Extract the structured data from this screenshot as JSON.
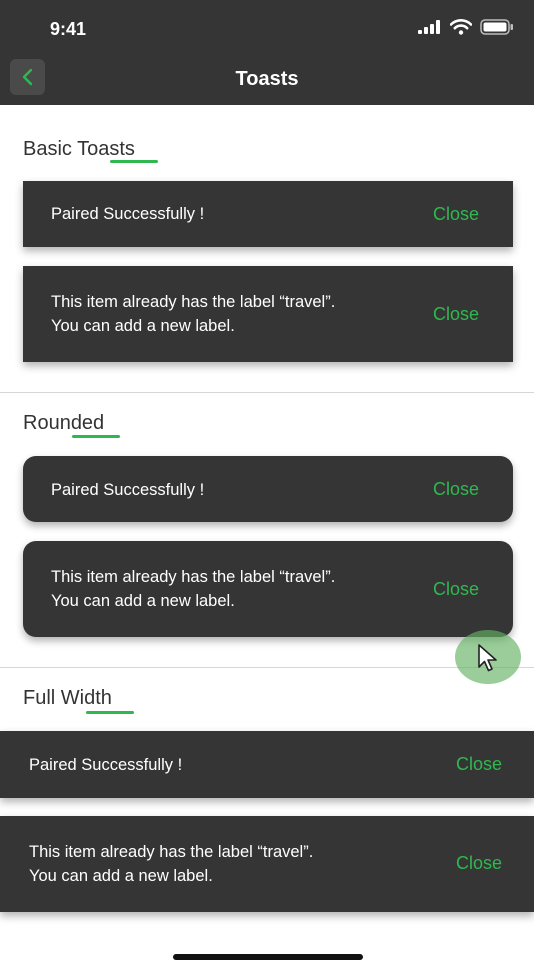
{
  "status_bar": {
    "time": "9:41",
    "icons": [
      "signal-icon",
      "wifi-icon",
      "battery-icon"
    ]
  },
  "nav": {
    "title": "Toasts",
    "back_icon": "chevron-left-icon"
  },
  "colors": {
    "bar_background": "#353535",
    "toast_background": "#353535",
    "accent": "#2fb84f",
    "text_light": "#ffffff",
    "section_text": "#333333"
  },
  "sections": [
    {
      "title": "Basic Toasts",
      "toasts": [
        {
          "message": "Paired Successfully !",
          "action": "Close"
        },
        {
          "message": "This item already has the label “travel”. You can add a new label.",
          "action": "Close"
        }
      ]
    },
    {
      "title": "Rounded",
      "toasts": [
        {
          "message": "Paired Successfully !",
          "action": "Close"
        },
        {
          "message": "This item already has the label “travel”. You can add a new label.",
          "action": "Close"
        }
      ]
    },
    {
      "title": "Full Width",
      "toasts": [
        {
          "message": "Paired Successfully !",
          "action": "Close"
        },
        {
          "message": "This item already has the label “travel”. You can add a new label.",
          "action": "Close"
        }
      ]
    }
  ]
}
